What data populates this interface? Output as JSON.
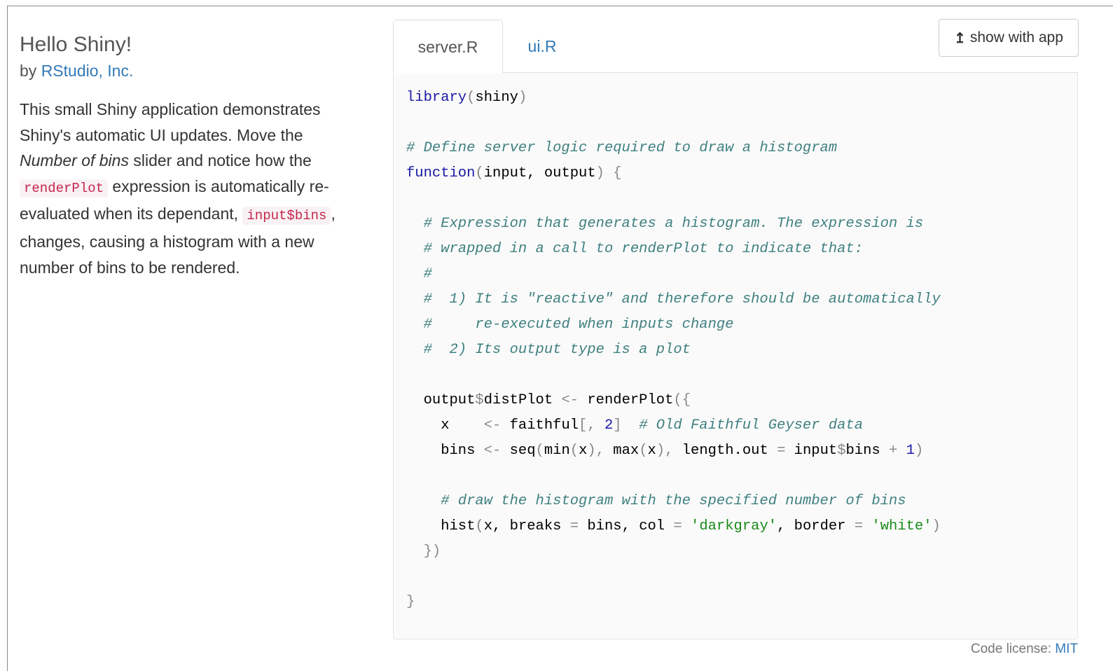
{
  "sidebar": {
    "title": "Hello Shiny!",
    "byline_prefix": "by ",
    "author": "RStudio, Inc.",
    "description": {
      "p1": "This small Shiny application demonstrates Shiny's automatic UI updates. Move the ",
      "em": "Number of bins",
      "p2": " slider and notice how the ",
      "code1": "renderPlot",
      "p3": " expression is automatically re-evaluated when its dependant, ",
      "code2": "input$bins",
      "p4": ", changes, causing a histogram with a new number of bins to be rendered."
    }
  },
  "tabs": [
    {
      "label": "server.R",
      "active": true
    },
    {
      "label": "ui.R",
      "active": false
    }
  ],
  "show_app_button": {
    "icon": "arrow-up-icon",
    "label": "show with app"
  },
  "code": {
    "lines": [
      [
        [
          "kw",
          "library"
        ],
        [
          "pn",
          "("
        ],
        [
          "id",
          "shiny"
        ],
        [
          "pn",
          ")"
        ]
      ],
      [],
      [
        [
          "cm",
          "# Define server logic required to draw a histogram"
        ]
      ],
      [
        [
          "kw",
          "function"
        ],
        [
          "pn",
          "("
        ],
        [
          "id",
          "input, output"
        ],
        [
          "pn",
          ") {"
        ]
      ],
      [],
      [
        [
          "id",
          "  "
        ],
        [
          "cm",
          "# Expression that generates a histogram. The expression is"
        ]
      ],
      [
        [
          "id",
          "  "
        ],
        [
          "cm",
          "# wrapped in a call to renderPlot to indicate that:"
        ]
      ],
      [
        [
          "id",
          "  "
        ],
        [
          "cm",
          "#"
        ]
      ],
      [
        [
          "id",
          "  "
        ],
        [
          "cm",
          "#  1) It is \"reactive\" and therefore should be automatically"
        ]
      ],
      [
        [
          "id",
          "  "
        ],
        [
          "cm",
          "#     re-executed when inputs change"
        ]
      ],
      [
        [
          "id",
          "  "
        ],
        [
          "cm",
          "#  2) Its output type is a plot"
        ]
      ],
      [],
      [
        [
          "id",
          "  output"
        ],
        [
          "op",
          "$"
        ],
        [
          "id",
          "distPlot "
        ],
        [
          "op",
          "<-"
        ],
        [
          "id",
          " renderPlot"
        ],
        [
          "pn",
          "({"
        ]
      ],
      [
        [
          "id",
          "    x    "
        ],
        [
          "op",
          "<-"
        ],
        [
          "id",
          " faithful"
        ],
        [
          "pn",
          "[, "
        ],
        [
          "num",
          "2"
        ],
        [
          "pn",
          "]"
        ],
        [
          "id",
          "  "
        ],
        [
          "cm",
          "# Old Faithful Geyser data"
        ]
      ],
      [
        [
          "id",
          "    bins "
        ],
        [
          "op",
          "<-"
        ],
        [
          "id",
          " seq"
        ],
        [
          "pn",
          "("
        ],
        [
          "id",
          "min"
        ],
        [
          "pn",
          "("
        ],
        [
          "id",
          "x"
        ],
        [
          "pn",
          "), "
        ],
        [
          "id",
          "max"
        ],
        [
          "pn",
          "("
        ],
        [
          "id",
          "x"
        ],
        [
          "pn",
          "), "
        ],
        [
          "id",
          "length.out "
        ],
        [
          "op",
          "="
        ],
        [
          "id",
          " input"
        ],
        [
          "op",
          "$"
        ],
        [
          "id",
          "bins "
        ],
        [
          "op",
          "+"
        ],
        [
          "id",
          " "
        ],
        [
          "num",
          "1"
        ],
        [
          "pn",
          ")"
        ]
      ],
      [],
      [
        [
          "id",
          "    "
        ],
        [
          "cm",
          "# draw the histogram with the specified number of bins"
        ]
      ],
      [
        [
          "id",
          "    hist"
        ],
        [
          "pn",
          "("
        ],
        [
          "id",
          "x, breaks "
        ],
        [
          "op",
          "="
        ],
        [
          "id",
          " bins, col "
        ],
        [
          "op",
          "="
        ],
        [
          "id",
          " "
        ],
        [
          "str",
          "'darkgray'"
        ],
        [
          "id",
          ", border "
        ],
        [
          "op",
          "="
        ],
        [
          "id",
          " "
        ],
        [
          "str",
          "'white'"
        ],
        [
          "pn",
          ")"
        ]
      ],
      [
        [
          "id",
          "  "
        ],
        [
          "pn",
          "})"
        ]
      ],
      [],
      [
        [
          "pn",
          "}"
        ]
      ]
    ]
  },
  "footer": {
    "license_prefix": "Code license: ",
    "license_link": "MIT"
  },
  "colors": {
    "link": "#337ab7",
    "keyword": "#1a1aa6",
    "comment": "#408080",
    "string": "#1a8a1a",
    "inline_code": "#c7254e"
  }
}
